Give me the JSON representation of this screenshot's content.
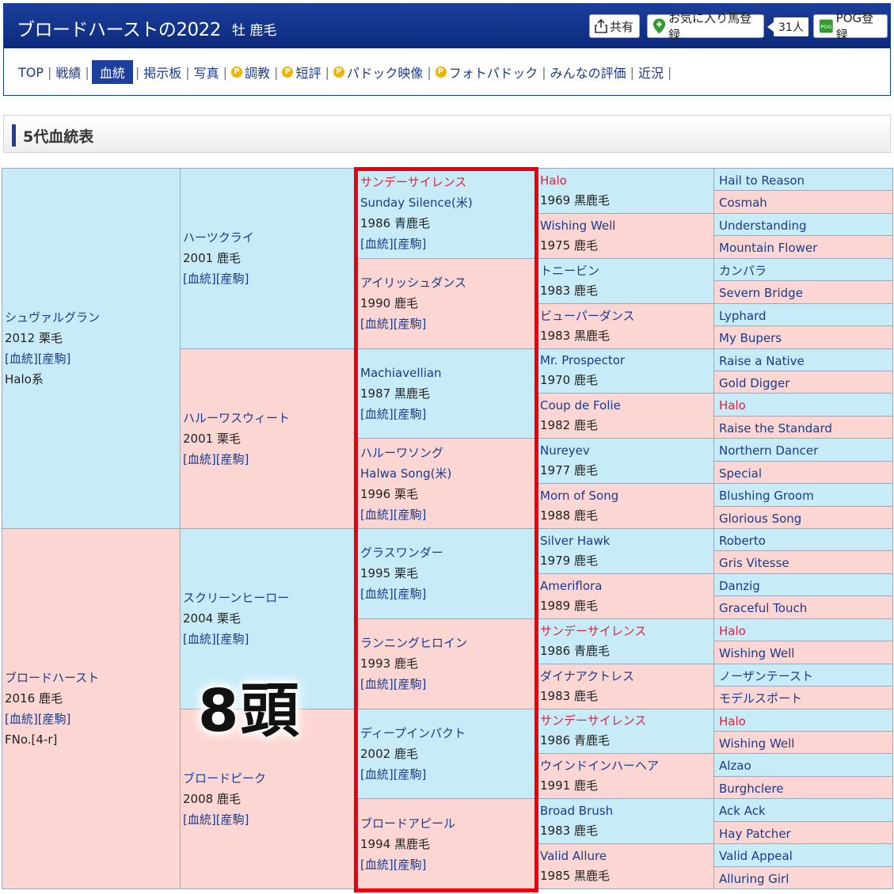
{
  "header": {
    "title": "ブロードハーストの2022",
    "subtitle": "牡 鹿毛",
    "share_label": "共有",
    "favorite_label": "お気に入り馬登録",
    "favorite_count": "31人",
    "pog_label": "POG登録",
    "pog_icon_text": "POG"
  },
  "nav": {
    "items": [
      {
        "label": "TOP",
        "active": false,
        "premium": false
      },
      {
        "label": "戦績",
        "active": false,
        "premium": false
      },
      {
        "label": "血統",
        "active": true,
        "premium": false
      },
      {
        "label": "掲示板",
        "active": false,
        "premium": false
      },
      {
        "label": "写真",
        "active": false,
        "premium": false
      },
      {
        "label": "調教",
        "active": false,
        "premium": true
      },
      {
        "label": "短評",
        "active": false,
        "premium": true
      },
      {
        "label": "パドック映像",
        "active": false,
        "premium": true
      },
      {
        "label": "フォトパドック",
        "active": false,
        "premium": true
      },
      {
        "label": "みんなの評価",
        "active": false,
        "premium": false
      },
      {
        "label": "近況",
        "active": false,
        "premium": false
      }
    ],
    "premium_icon_text": "P"
  },
  "section": {
    "title": "5代血統表"
  },
  "pedigree": {
    "links_text": "[血統][産駒]",
    "gen1": [
      {
        "name": "シュヴァルグラン",
        "year": "2012 栗毛",
        "note": "Halo系",
        "sex": "s"
      },
      {
        "name": "ブロードハースト",
        "year": "2016 鹿毛",
        "note": "FNo.[4-r]",
        "sex": "d"
      }
    ],
    "gen2": [
      {
        "name": "ハーツクライ",
        "year": "2001 鹿毛",
        "sex": "s"
      },
      {
        "name": "ハルーワスウィート",
        "year": "2001 栗毛",
        "sex": "d"
      },
      {
        "name": "スクリーンヒーロー",
        "year": "2004 栗毛",
        "sex": "s"
      },
      {
        "name": "ブロードピーク",
        "year": "2008 鹿毛",
        "sex": "d"
      }
    ],
    "gen3": [
      {
        "name": "サンデーサイレンス",
        "alt": "Sunday Silence(米)",
        "year": "1986 青鹿毛",
        "sex": "s",
        "red": true
      },
      {
        "name": "アイリッシュダンス",
        "year": "1990 鹿毛",
        "sex": "d"
      },
      {
        "name": "Machiavellian",
        "year": "1987 黒鹿毛",
        "sex": "s"
      },
      {
        "name": "ハルーワソング",
        "alt": "Halwa Song(米)",
        "year": "1996 栗毛",
        "sex": "d"
      },
      {
        "name": "グラスワンダー",
        "year": "1995 栗毛",
        "sex": "s"
      },
      {
        "name": "ランニングヒロイン",
        "year": "1993 鹿毛",
        "sex": "d"
      },
      {
        "name": "ディープインパクト",
        "year": "2002 鹿毛",
        "sex": "s"
      },
      {
        "name": "ブロードアピール",
        "year": "1994 黒鹿毛",
        "sex": "d"
      }
    ],
    "gen4": [
      {
        "name": "Halo",
        "year": "1969 黒鹿毛",
        "sex": "s",
        "red": true
      },
      {
        "name": "Wishing Well",
        "year": "1975 鹿毛",
        "sex": "d"
      },
      {
        "name": "トニービン",
        "year": "1983 鹿毛",
        "sex": "s"
      },
      {
        "name": "ビューパーダンス",
        "year": "1983 黒鹿毛",
        "sex": "d"
      },
      {
        "name": "Mr. Prospector",
        "year": "1970 鹿毛",
        "sex": "s"
      },
      {
        "name": "Coup de Folie",
        "year": "1982 鹿毛",
        "sex": "d"
      },
      {
        "name": "Nureyev",
        "year": "1977 鹿毛",
        "sex": "s"
      },
      {
        "name": "Morn of Song",
        "year": "1988 鹿毛",
        "sex": "d"
      },
      {
        "name": "Silver Hawk",
        "year": "1979 鹿毛",
        "sex": "s"
      },
      {
        "name": "Ameriflora",
        "year": "1989 鹿毛",
        "sex": "d"
      },
      {
        "name": "サンデーサイレンス",
        "year": "1986 青鹿毛",
        "sex": "s",
        "red": true
      },
      {
        "name": "ダイナアクトレス",
        "year": "1983 鹿毛",
        "sex": "d"
      },
      {
        "name": "サンデーサイレンス",
        "year": "1986 青鹿毛",
        "sex": "s",
        "red": true
      },
      {
        "name": "ウインドインハーヘア",
        "year": "1991 鹿毛",
        "sex": "d"
      },
      {
        "name": "Broad Brush",
        "year": "1983 鹿毛",
        "sex": "s"
      },
      {
        "name": "Valid Allure",
        "year": "1985 黒鹿毛",
        "sex": "d"
      }
    ],
    "gen5": [
      {
        "name": "Hail to Reason",
        "sex": "s"
      },
      {
        "name": "Cosmah",
        "sex": "d"
      },
      {
        "name": "Understanding",
        "sex": "s"
      },
      {
        "name": "Mountain Flower",
        "sex": "d"
      },
      {
        "name": "カンパラ",
        "sex": "s"
      },
      {
        "name": "Severn Bridge",
        "sex": "d"
      },
      {
        "name": "Lyphard",
        "sex": "s"
      },
      {
        "name": "My Bupers",
        "sex": "d"
      },
      {
        "name": "Raise a Native",
        "sex": "s"
      },
      {
        "name": "Gold Digger",
        "sex": "d"
      },
      {
        "name": "Halo",
        "sex": "s",
        "red": true
      },
      {
        "name": "Raise the Standard",
        "sex": "d"
      },
      {
        "name": "Northern Dancer",
        "sex": "s"
      },
      {
        "name": "Special",
        "sex": "d"
      },
      {
        "name": "Blushing Groom",
        "sex": "s"
      },
      {
        "name": "Glorious Song",
        "sex": "d"
      },
      {
        "name": "Roberto",
        "sex": "s"
      },
      {
        "name": "Gris Vitesse",
        "sex": "d"
      },
      {
        "name": "Danzig",
        "sex": "s"
      },
      {
        "name": "Graceful Touch",
        "sex": "d"
      },
      {
        "name": "Halo",
        "sex": "s",
        "red": true
      },
      {
        "name": "Wishing Well",
        "sex": "d"
      },
      {
        "name": "ノーザンテースト",
        "sex": "s"
      },
      {
        "name": "モデルスポート",
        "sex": "d"
      },
      {
        "name": "Halo",
        "sex": "s",
        "red": true
      },
      {
        "name": "Wishing Well",
        "sex": "d"
      },
      {
        "name": "Alzao",
        "sex": "s"
      },
      {
        "name": "Burghclere",
        "sex": "d"
      },
      {
        "name": "Ack Ack",
        "sex": "s"
      },
      {
        "name": "Hay Patcher",
        "sex": "d"
      },
      {
        "name": "Valid Appeal",
        "sex": "s"
      },
      {
        "name": "Alluring Girl",
        "sex": "d"
      }
    ]
  },
  "annotation": {
    "count_label": "8頭"
  },
  "colors": {
    "header_bg": "#1c3f9c",
    "sire_bg": "#c7ecf8",
    "dam_bg": "#fbd6d2",
    "highlight": "#e8000e",
    "red_name": "#e0233e"
  }
}
